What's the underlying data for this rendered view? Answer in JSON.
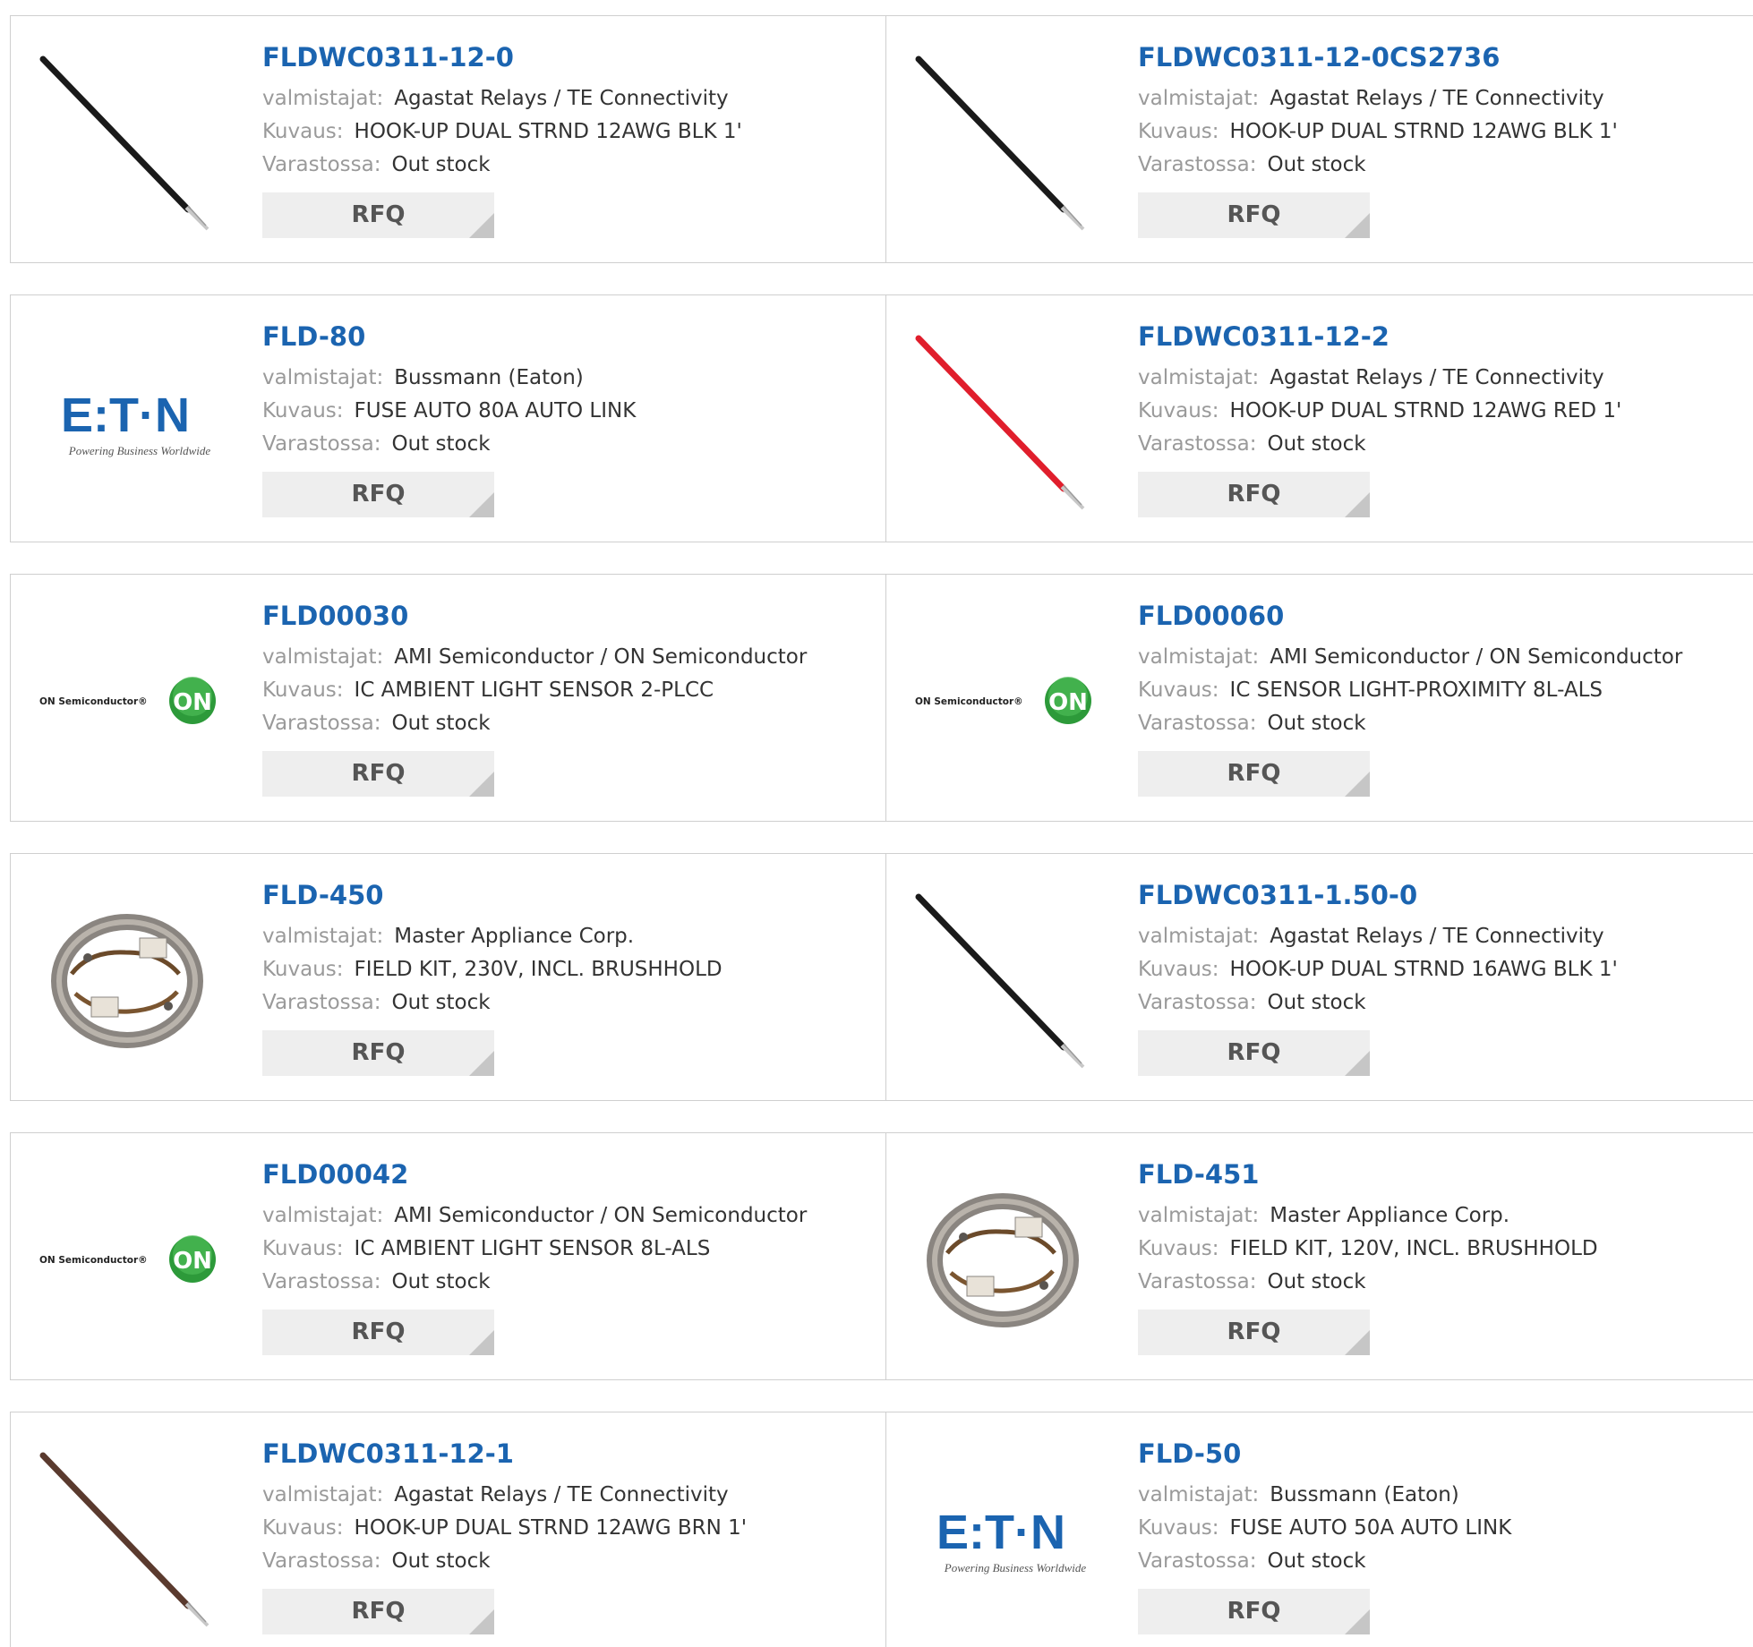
{
  "labels": {
    "manufacturer": "valmistajat:",
    "description": "Kuvaus:",
    "stock": "Varastossa:",
    "rfq": "RFQ"
  },
  "colors": {
    "part_number": "#1b64b0",
    "label": "#9a9a9a",
    "value": "#333333",
    "rfq_bg": "#eeeeee"
  },
  "products": [
    {
      "part": "FLDWC0311-12-0",
      "manufacturer": "Agastat Relays / TE Connectivity",
      "description": "HOOK-UP DUAL STRND 12AWG BLK 1'",
      "stock": "Out stock",
      "image": "black-wire-image"
    },
    {
      "part": "FLDWC0311-12-0CS2736",
      "manufacturer": "Agastat Relays / TE Connectivity",
      "description": "HOOK-UP DUAL STRND 12AWG BLK 1'",
      "stock": "Out stock",
      "image": "black-wire-image"
    },
    {
      "part": "FLD-80",
      "manufacturer": "Bussmann (Eaton)",
      "description": "FUSE AUTO 80A AUTO LINK",
      "stock": "Out stock",
      "image": "eaton-logo",
      "logo_text": "E:T·N",
      "logo_tagline": "Powering Business Worldwide"
    },
    {
      "part": "FLDWC0311-12-2",
      "manufacturer": "Agastat Relays / TE Connectivity",
      "description": "HOOK-UP DUAL STRND 12AWG RED 1'",
      "stock": "Out stock",
      "image": "red-wire-image"
    },
    {
      "part": "FLD00030",
      "manufacturer": "AMI Semiconductor / ON Semiconductor",
      "description": "IC AMBIENT LIGHT SENSOR 2-PLCC",
      "stock": "Out stock",
      "image": "on-semiconductor-logo",
      "logo_text": "ON Semiconductor®",
      "logo_badge": "ON"
    },
    {
      "part": "FLD00060",
      "manufacturer": "AMI Semiconductor / ON Semiconductor",
      "description": "IC SENSOR LIGHT-PROXIMITY 8L-ALS",
      "stock": "Out stock",
      "image": "on-semiconductor-logo",
      "logo_text": "ON Semiconductor®",
      "logo_badge": "ON"
    },
    {
      "part": "FLD-450",
      "manufacturer": "Master Appliance Corp.",
      "description": "FIELD KIT, 230V, INCL. BRUSHHOLD",
      "stock": "Out stock",
      "image": "field-kit-image"
    },
    {
      "part": "FLDWC0311-1.50-0",
      "manufacturer": "Agastat Relays / TE Connectivity",
      "description": "HOOK-UP DUAL STRND 16AWG BLK 1'",
      "stock": "Out stock",
      "image": "black-wire-image"
    },
    {
      "part": "FLD00042",
      "manufacturer": "AMI Semiconductor / ON Semiconductor",
      "description": "IC AMBIENT LIGHT SENSOR 8L-ALS",
      "stock": "Out stock",
      "image": "on-semiconductor-logo",
      "logo_text": "ON Semiconductor®",
      "logo_badge": "ON"
    },
    {
      "part": "FLD-451",
      "manufacturer": "Master Appliance Corp.",
      "description": "FIELD KIT, 120V, INCL. BRUSHHOLD",
      "stock": "Out stock",
      "image": "field-kit-image"
    },
    {
      "part": "FLDWC0311-12-1",
      "manufacturer": "Agastat Relays / TE Connectivity",
      "description": "HOOK-UP DUAL STRND 12AWG BRN 1'",
      "stock": "Out stock",
      "image": "brown-wire-image"
    },
    {
      "part": "FLD-50",
      "manufacturer": "Bussmann (Eaton)",
      "description": "FUSE AUTO 50A AUTO LINK",
      "stock": "Out stock",
      "image": "eaton-logo",
      "logo_text": "E:T·N",
      "logo_tagline": "Powering Business Worldwide"
    }
  ]
}
